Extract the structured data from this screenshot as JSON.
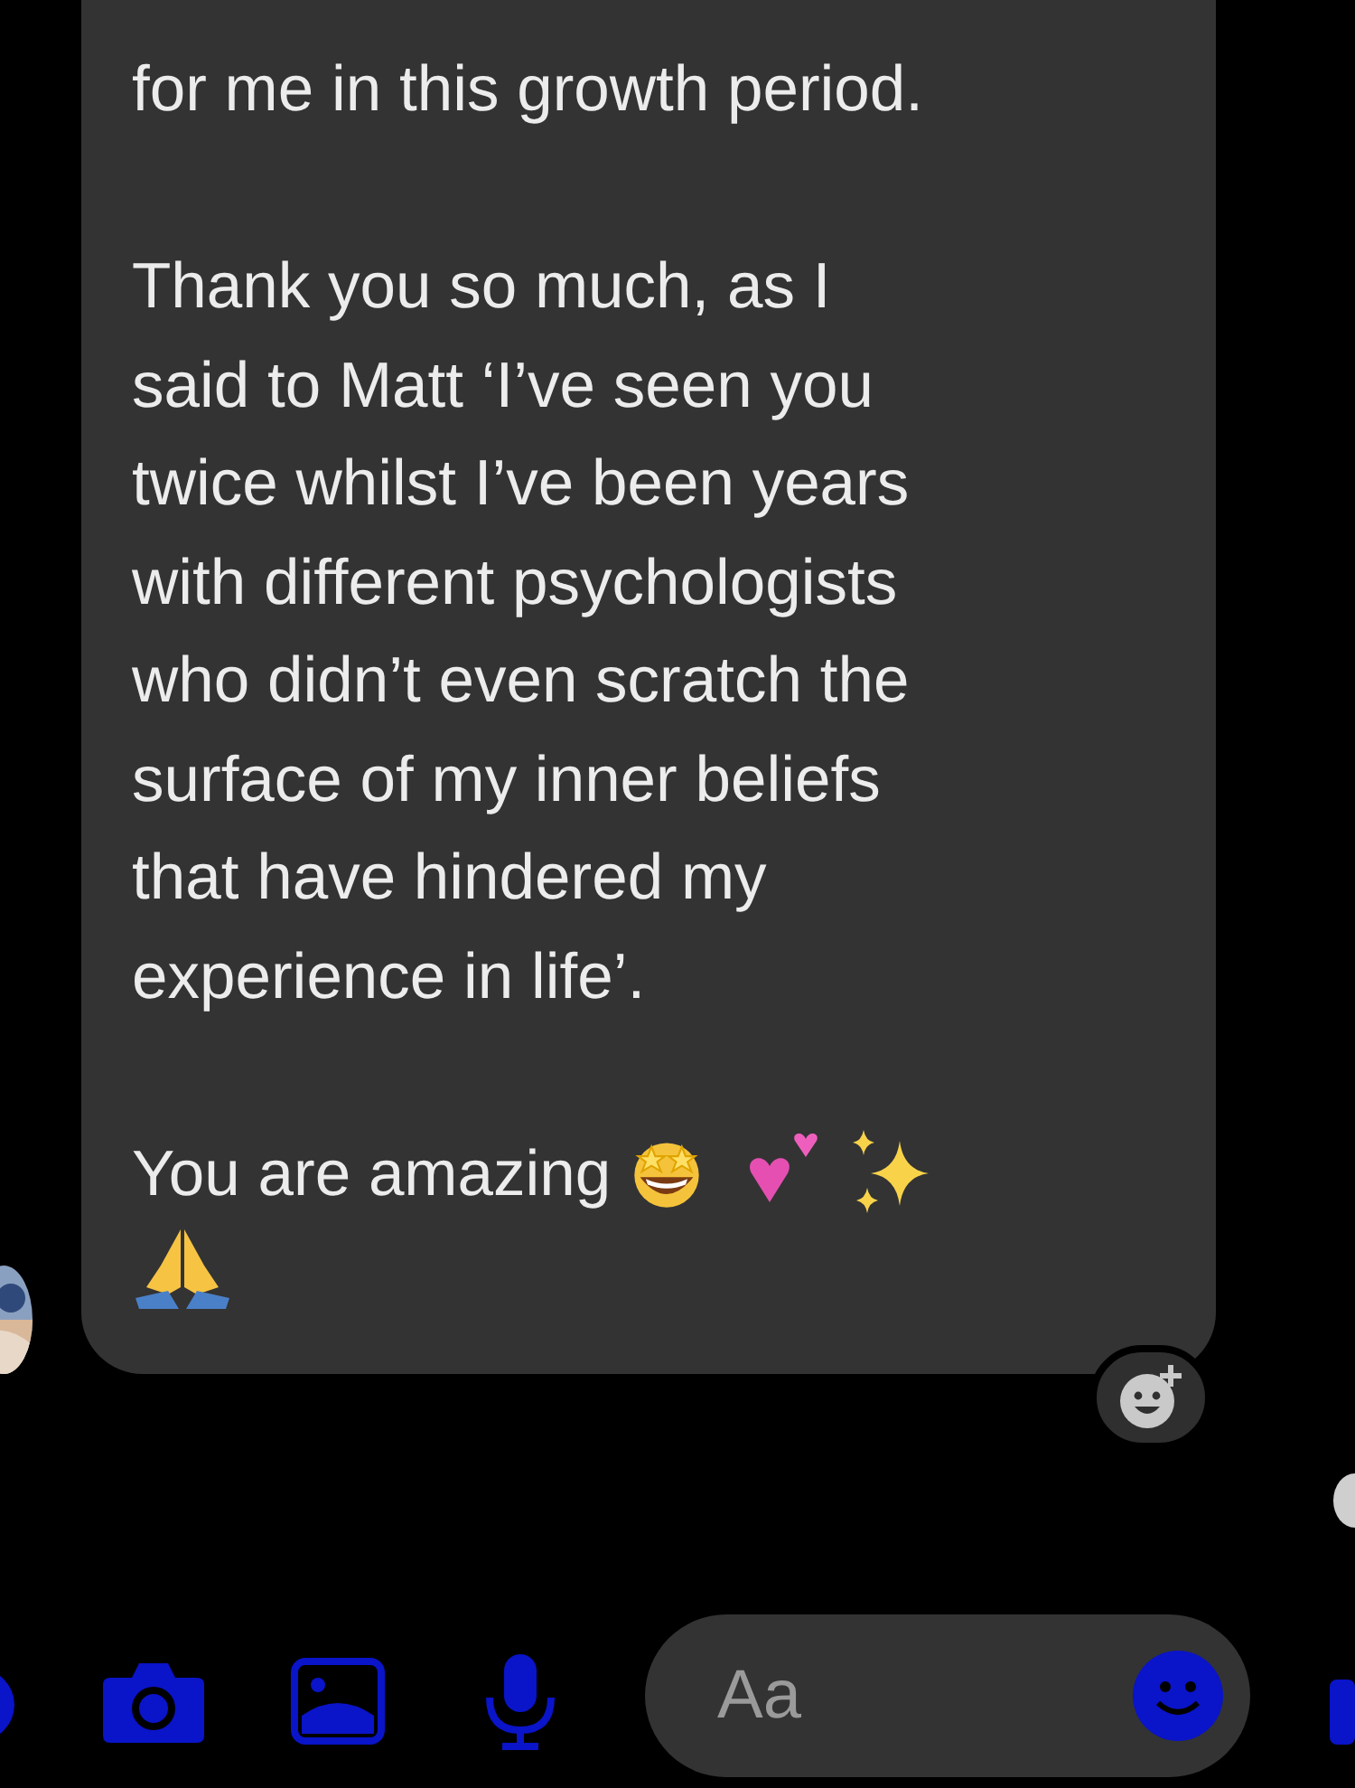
{
  "message": {
    "paragraphs": [
      "for me in this growth period.",
      "Thank you so much, as I\nsaid to Matt ‘I’ve seen you\ntwice whilst I’ve been years\nwith different psychologists\nwho didn’t even scratch the\nsurface of my inner beliefs\nthat have hindered my\nexperience in life’.",
      "You are amazing"
    ]
  },
  "composer": {
    "placeholder": "Aa"
  }
}
